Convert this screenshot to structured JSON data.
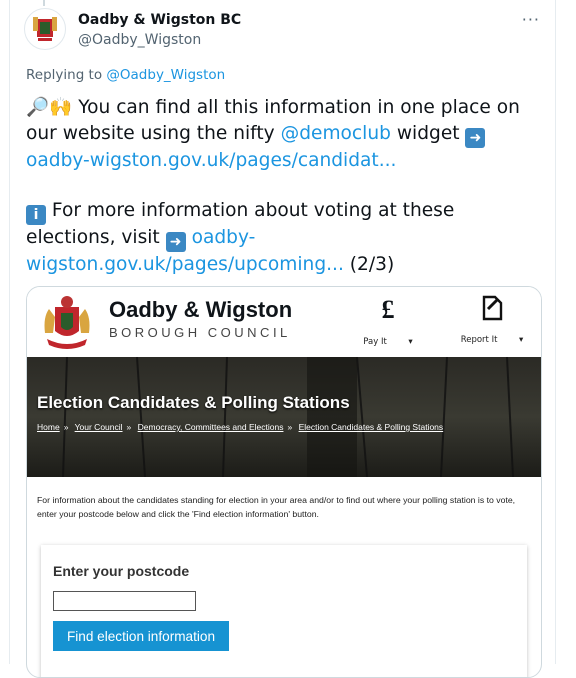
{
  "tweet": {
    "display_name": "Oadby & Wigston BC",
    "handle": "@Oadby_Wigston",
    "more_label": "···",
    "replying_prefix": "Replying to",
    "replying_to": "@Oadby_Wigston",
    "p1_a": "You can find all this information in one place on our website using the nifty",
    "p1_mention": "@democlub",
    "p1_b": "widget",
    "p1_link": "oadby-wigston.gov.uk/pages/candidat...",
    "p2_a": "For more information about voting at these elections, visit",
    "p2_link": "oadby-wigston.gov.uk/pages/upcoming...",
    "p2_b": "(2/3)",
    "emoji_1": "🔎🙌",
    "emoji_2": "➡️",
    "emoji_3": "ℹ️"
  },
  "card": {
    "council_name": "Oadby & Wigston",
    "council_sub": "BOROUGH COUNCIL",
    "pay_icon": "£",
    "pay_label": "Pay It",
    "report_label": "Report It",
    "hero_title": "Election Candidates & Polling Stations",
    "breadcrumbs": [
      "Home",
      "Your Council",
      "Democracy, Committees and Elections",
      "Election Candidates & Polling Stations"
    ],
    "info_text": "For information about the candidates standing for election in your area and/or to find out where your polling station is to vote, enter your postcode below and click the 'Find election information' button.",
    "postcode_label": "Enter your postcode",
    "postcode_value": "",
    "find_button": "Find election information"
  },
  "colors": {
    "link": "#1b95e0",
    "button": "#1693d2"
  }
}
